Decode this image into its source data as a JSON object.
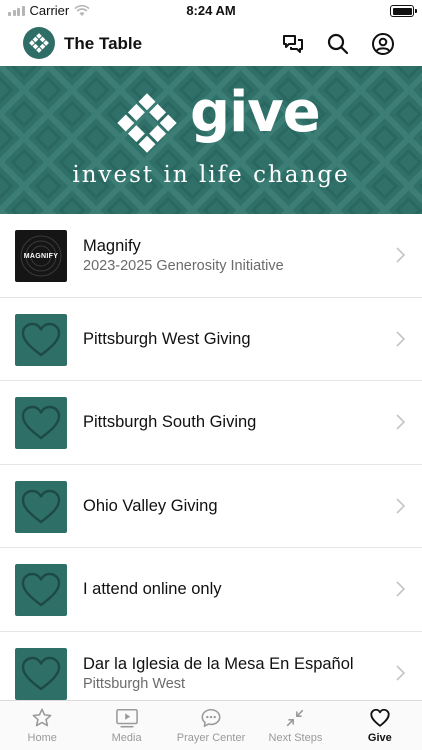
{
  "status_bar": {
    "carrier": "Carrier",
    "time": "8:24 AM"
  },
  "header": {
    "title": "The Table"
  },
  "banner": {
    "word": "give",
    "tagline": "invest in life change"
  },
  "items": [
    {
      "thumb": "magnify",
      "thumb_text": "MAGNIFY",
      "title": "Magnify",
      "subtitle": "2023-2025 Generosity Initiative"
    },
    {
      "thumb": "heart",
      "title": "Pittsburgh West Giving",
      "subtitle": ""
    },
    {
      "thumb": "heart",
      "title": "Pittsburgh South Giving",
      "subtitle": ""
    },
    {
      "thumb": "heart",
      "title": "Ohio Valley Giving",
      "subtitle": ""
    },
    {
      "thumb": "heart",
      "title": "I attend online only",
      "subtitle": ""
    },
    {
      "thumb": "heart",
      "title": "Dar la Iglesia de la Mesa En Español",
      "subtitle": "Pittsburgh West"
    }
  ],
  "tabs": [
    {
      "label": "Home",
      "icon": "star-icon",
      "active": false
    },
    {
      "label": "Media",
      "icon": "play-icon",
      "active": false
    },
    {
      "label": "Prayer Center",
      "icon": "chat-bubble-icon",
      "active": false
    },
    {
      "label": "Next Steps",
      "icon": "arrows-icon",
      "active": false
    },
    {
      "label": "Give",
      "icon": "heart-icon",
      "active": true
    }
  ],
  "colors": {
    "brand": "#2e6e66",
    "banner": "#2f7068"
  }
}
